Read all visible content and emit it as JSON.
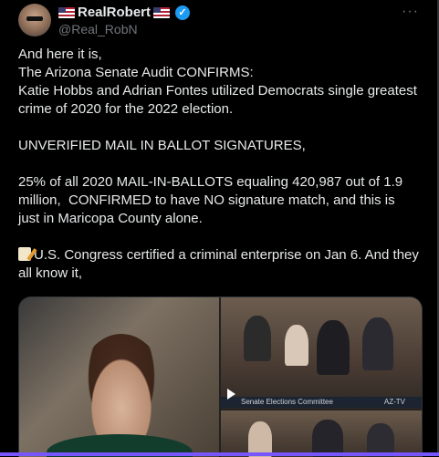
{
  "tweet": {
    "display_name": "RealRobert",
    "handle": "@Real_RobN",
    "more_label": "···",
    "verified_mark": "✓",
    "lines": [
      "And here it is,",
      "The Arizona Senate Audit CONFIRMS:",
      "Katie Hobbs and Adrian Fontes utilized Democrats single greatest crime of 2020 for the 2022 election.",
      "",
      "UNVERIFIED MAIL IN BALLOT SIGNATURES,",
      "",
      "25% of all 2020 MAIL-IN-BALLOTS equaling 420,987 out of 1.9 million,  CONFIRMED to have NO signature match, and this is just in Maricopa County alone.",
      "",
      "U.S. Congress certified a criminal enterprise on Jan 6. And they all know it,"
    ]
  },
  "media": {
    "caption_left": "Senate Elections Committee",
    "caption_right": "AZ-TV"
  },
  "icons": {
    "flag": "us-flag-icon",
    "verified": "verified-badge-icon",
    "memo": "memo-icon",
    "play": "play-icon"
  },
  "colors": {
    "background": "#000000",
    "text": "#e7e9ea",
    "muted": "#71767b",
    "verified": "#1d9bf0",
    "accent_bar": "#7856ff"
  }
}
